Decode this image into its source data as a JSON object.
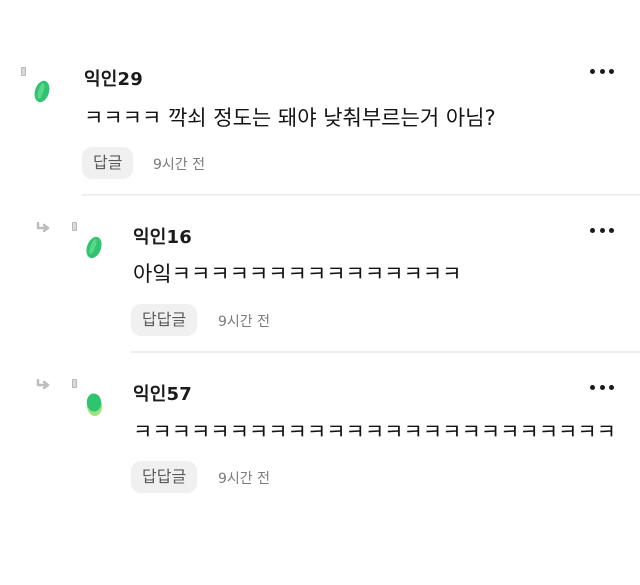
{
  "comments": [
    {
      "author": "익인29",
      "text": "ㅋㅋㅋㅋ 깍쇠 정도는 돼야 낮춰부르는거 아님?",
      "reply_label": "답글",
      "time": "9시간 전"
    },
    {
      "author": "익인16",
      "text": "아잌ㅋㅋㅋㅋㅋㅋㅋㅋㅋㅋㅋㅋㅋㅋㅋ",
      "reply_label": "답답글",
      "time": "9시간 전"
    },
    {
      "author": "익인57",
      "text": "ㅋㅋㅋㅋㅋㅋㅋㅋㅋㅋㅋㅋㅋㅋㅋㅋㅋㅋㅋㅋㅋㅋㅋㅋㅋ",
      "reply_label": "답답글",
      "time": "9시간 전"
    }
  ],
  "icons": {
    "avatar": "green-leaf-avatar-icon",
    "more": "more-options-icon",
    "reply_arrow": "reply-arrow-icon",
    "marker": "small-marker-icon"
  },
  "colors": {
    "avatar_primary": "#2fc46f",
    "avatar_secondary": "#9be37a",
    "button_bg": "#f0f0f0",
    "divider": "#eeeeee",
    "muted_text": "#7b7b7b"
  }
}
